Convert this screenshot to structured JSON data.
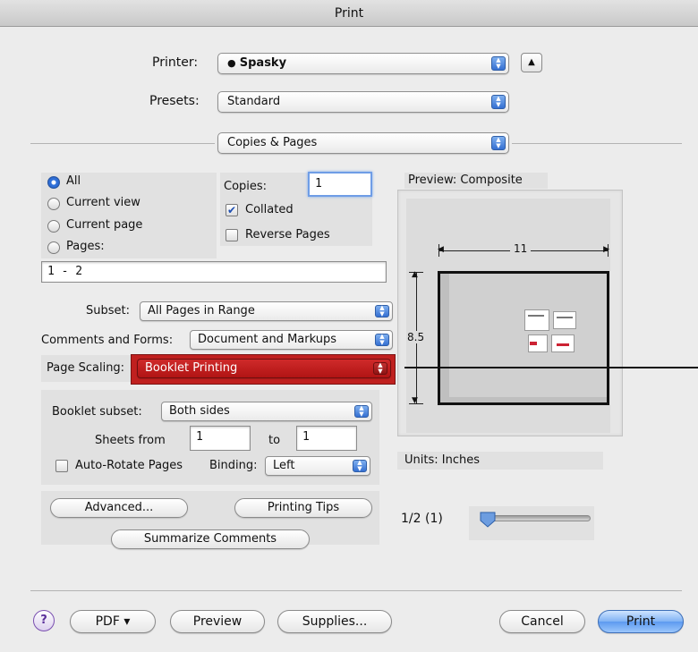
{
  "window": {
    "title": "Print"
  },
  "top": {
    "printer_label": "Printer:",
    "printer_value": "Spasky",
    "presets_label": "Presets:",
    "presets_value": "Standard",
    "section_value": "Copies & Pages"
  },
  "range": {
    "all": "All",
    "current_view": "Current view",
    "current_page": "Current page",
    "pages": "Pages:",
    "pages_value": "1 - 2",
    "selected": "All"
  },
  "copies": {
    "label": "Copies:",
    "value": "1",
    "collated_label": "Collated",
    "collated_checked": true,
    "reverse_label": "Reverse Pages",
    "reverse_checked": false
  },
  "subset": {
    "label": "Subset:",
    "value": "All Pages in Range"
  },
  "comments": {
    "label": "Comments and Forms:",
    "value": "Document and Markups"
  },
  "scaling": {
    "label": "Page Scaling:",
    "value": "Booklet Printing",
    "highlight_color": "#c0201f"
  },
  "booklet": {
    "subset_label": "Booklet subset:",
    "subset_value": "Both sides",
    "sheets_from_label": "Sheets from",
    "sheets_from_value": "1",
    "to_label": "to",
    "to_value": "1",
    "autorotate_label": "Auto-Rotate Pages",
    "autorotate_checked": false,
    "binding_label": "Binding:",
    "binding_value": "Left"
  },
  "buttons": {
    "advanced": "Advanced...",
    "tips": "Printing Tips",
    "summarize": "Summarize Comments",
    "pdf": "PDF ▾",
    "preview": "Preview",
    "supplies": "Supplies...",
    "cancel": "Cancel",
    "print": "Print",
    "help": "?"
  },
  "preview": {
    "header": "Preview: Composite",
    "width_label": "11",
    "height_label": "8.5",
    "units": "Units: Inches",
    "page_indicator": "1/2 (1)",
    "slider_position": 0.0
  },
  "colors": {
    "accent": "#3570d2",
    "scaling_highlight": "#c0201f"
  }
}
